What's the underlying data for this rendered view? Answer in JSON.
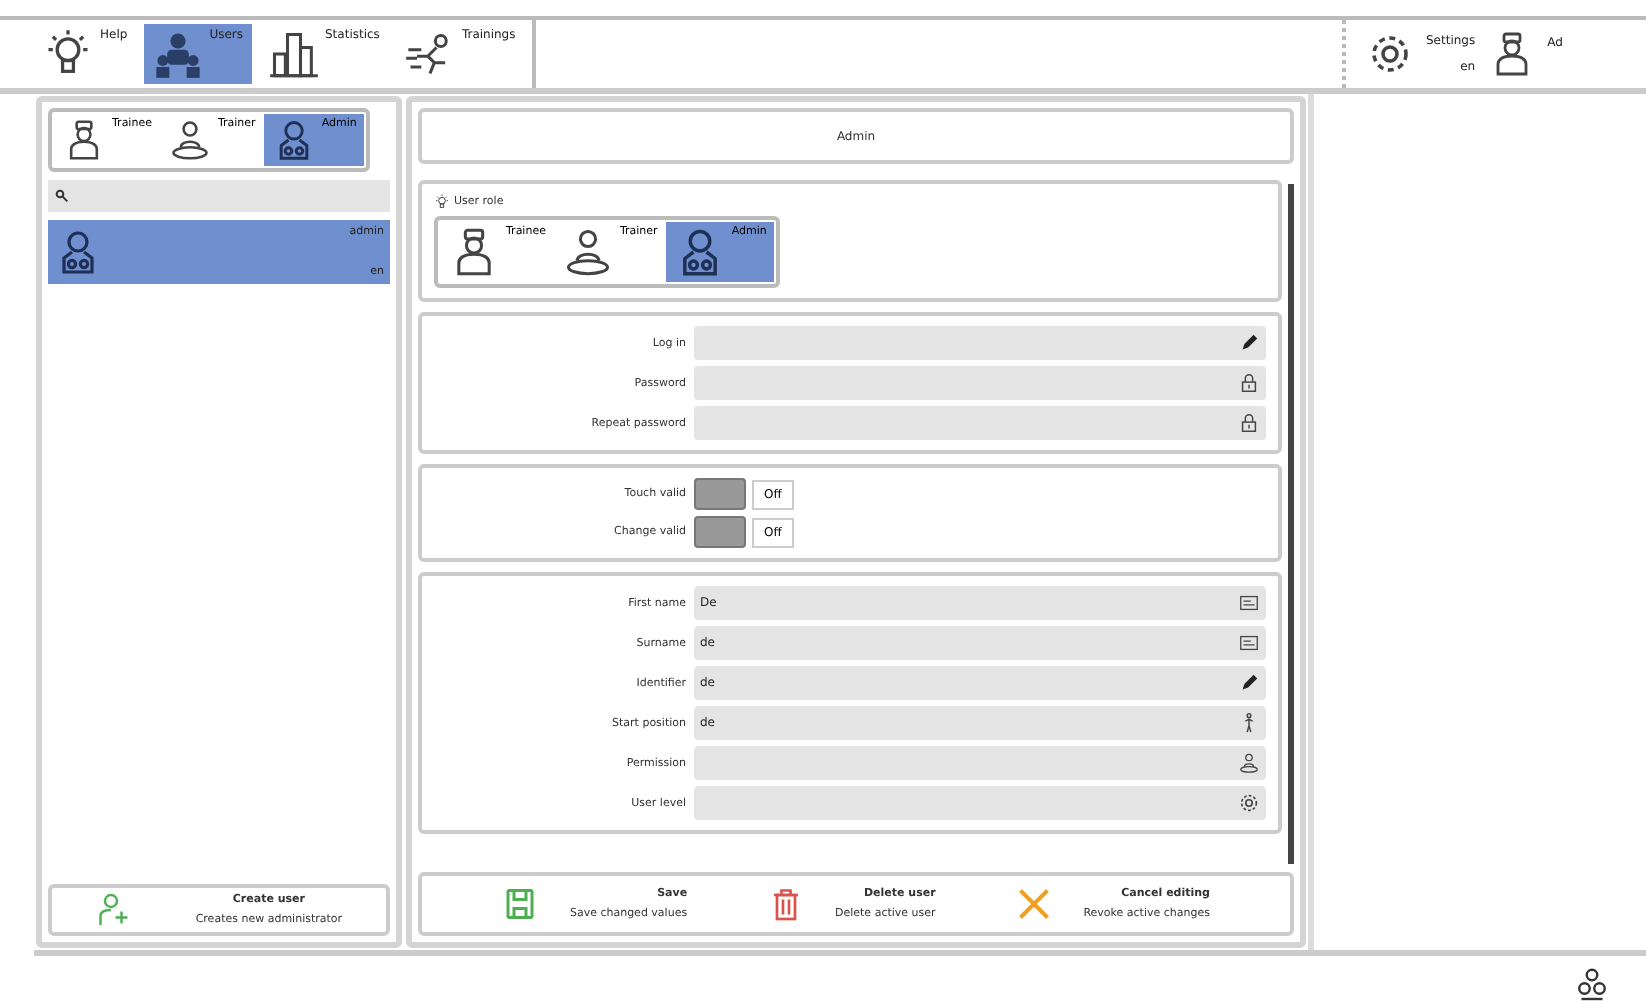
{
  "nav_tabs": [
    {
      "label": "Help",
      "kind": "bulb",
      "selected": false
    },
    {
      "label": "Users",
      "kind": "users",
      "selected": true
    },
    {
      "label": "Statistics",
      "kind": "chart",
      "selected": false
    },
    {
      "label": "Trainings",
      "kind": "run",
      "selected": false
    }
  ],
  "settings": {
    "label": "Settings",
    "sub": "en"
  },
  "current_user": {
    "label": "Ad"
  },
  "role_filter": [
    {
      "label": "Trainee",
      "kind": "trainee",
      "selected": false
    },
    {
      "label": "Trainer",
      "kind": "trainer",
      "selected": false
    },
    {
      "label": "Admin",
      "kind": "admin",
      "selected": true
    }
  ],
  "user_list": [
    {
      "name": "admin",
      "detail": "en",
      "selected": true
    }
  ],
  "create_button": {
    "title": "Create user",
    "subtitle": "Creates new administrator"
  },
  "header": {
    "title": "Admin"
  },
  "user_role": {
    "label": "User role",
    "options": [
      {
        "label": "Trainee",
        "kind": "trainee",
        "selected": false
      },
      {
        "label": "Trainer",
        "kind": "trainer",
        "selected": false
      },
      {
        "label": "Admin",
        "kind": "admin",
        "selected": true
      }
    ]
  },
  "credentials": [
    {
      "label": "Log in",
      "kind": "pencil"
    },
    {
      "label": "Password",
      "kind": "lock"
    },
    {
      "label": "Repeat password",
      "kind": "lock"
    }
  ],
  "toggles": [
    {
      "label": "Touch valid",
      "on": false,
      "value": "Off"
    },
    {
      "label": "Change valid",
      "on": false,
      "value": "Off"
    }
  ],
  "details": [
    {
      "label": "First name",
      "value": "De",
      "kind": "card"
    },
    {
      "label": "Surname",
      "value": "de",
      "kind": "card"
    },
    {
      "label": "Identifier",
      "value": "de",
      "kind": "pencil"
    },
    {
      "label": "Start position",
      "value": "de",
      "kind": "figure"
    },
    {
      "label": "Permission",
      "kind": "trainer"
    },
    {
      "label": "User level",
      "kind": "gear"
    }
  ],
  "actions": [
    {
      "title": "Save",
      "subtitle": "Save changed values",
      "kind": "save"
    },
    {
      "title": "Delete user",
      "subtitle": "Delete active user",
      "kind": "trash"
    },
    {
      "title": "Cancel editing",
      "subtitle": "Revoke active changes",
      "kind": "cancel"
    }
  ]
}
